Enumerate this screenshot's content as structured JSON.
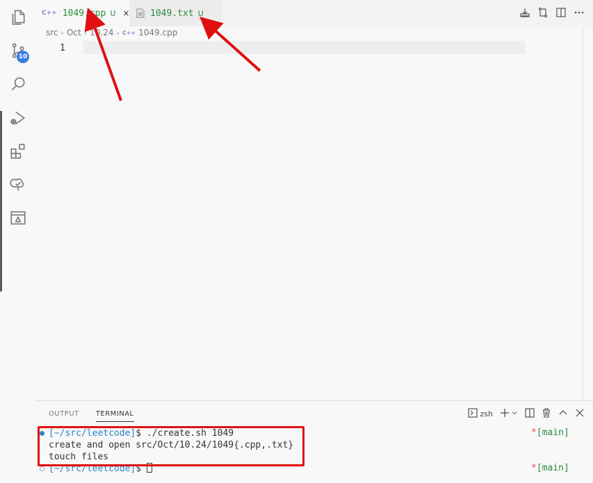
{
  "activity_bar": {
    "icons": [
      "files-icon",
      "source-control-icon",
      "search-icon",
      "run-debug-icon",
      "extensions-icon",
      "tree-icon",
      "remote-explorer-icon"
    ],
    "source_control_badge": "10"
  },
  "tabs": [
    {
      "file_icon": "C++",
      "name": "1049.cpp",
      "status": "U",
      "close": "×",
      "active": true
    },
    {
      "file_icon": "txt",
      "name": "1049.txt",
      "status": "U",
      "active": false
    }
  ],
  "breadcrumb": {
    "parts": [
      "src",
      "Oct",
      "10.24"
    ],
    "file_icon": "C++",
    "file": "1049.cpp"
  },
  "editor": {
    "line_number": "1"
  },
  "panel": {
    "tabs": [
      "OUTPUT",
      "TERMINAL"
    ],
    "active_tab": "TERMINAL",
    "shell_label": "zsh",
    "terminal": {
      "prompt": "[~/src/leetcode]",
      "dollar": "$",
      "command": " ./create.sh 1049",
      "output_1": "create and open src/Oct/10.24/1049{.cpp,.txt}",
      "output_2": "touch files",
      "prompt2": "[~/src/leetcode]",
      "dollar2": "$",
      "branch_star": "*",
      "branch": "[main]",
      "branch_star2": "*",
      "branch2": "[main]"
    }
  },
  "colors": {
    "accent_red": "#e01010",
    "git_untracked": "#2e8b3d",
    "badge_blue": "#3b7de0",
    "prompt_blue": "#2a82c6"
  }
}
